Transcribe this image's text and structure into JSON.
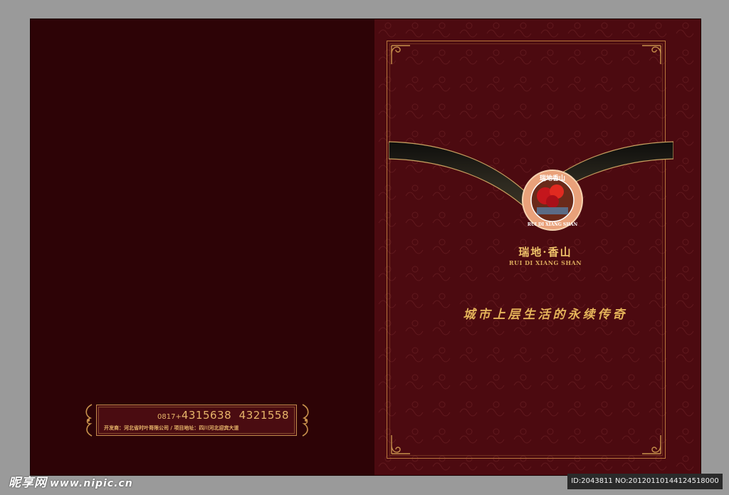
{
  "colors": {
    "bg": "#9a9a9a",
    "back_cover": "#2d0306",
    "front_cover": "#4c0a10",
    "gold": "#e5b45a"
  },
  "brand": {
    "logo_ring_text": "瑞地香山",
    "logo_ring_en": "RUI DI XIANG SHAN",
    "name_cn": "瑞地·香山",
    "name_en": "RUI DI XIANG SHAN"
  },
  "slogan": "城市上层生活的永续传奇",
  "contact": {
    "phone_prefix": "0817+",
    "phone": "4315638  4321558",
    "address": "开发商：河北省时叶哥限公司 /   项目地址：四川河北迎宾大道"
  },
  "watermark": {
    "brand": "昵享网",
    "url": "www.nipic.cn"
  },
  "image_id": "ID:2043811 NO:20120110144124518000"
}
